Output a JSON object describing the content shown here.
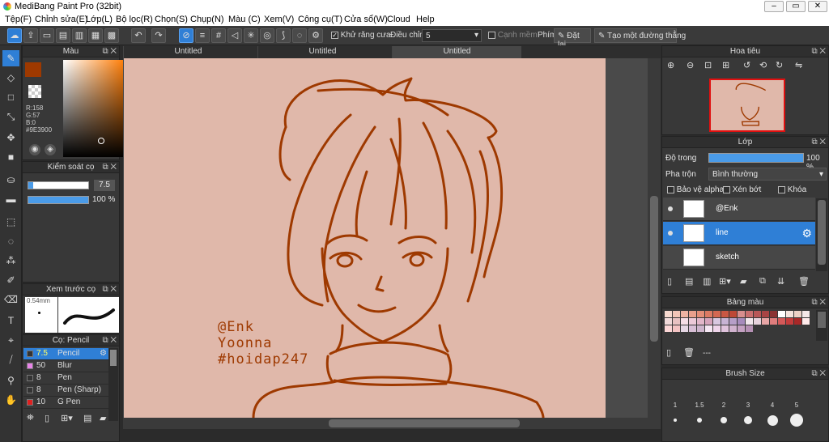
{
  "app": {
    "title": "MediBang Paint Pro (32bit)"
  },
  "menu": [
    "Tệp(F)",
    "Chỉnh sửa(E)",
    "Lớp(L)",
    "Bộ lọc(R)",
    "Chọn(S)",
    "Chụp(N)",
    "Màu (C)",
    "Xem(V)",
    "Công cụ(T)",
    "Cửa sổ(W)",
    "Cloud",
    "Help"
  ],
  "toolbar": {
    "antialias_label": "Khử răng cưa",
    "adjust_label": "Điều chỉnh",
    "adjust_value": "5",
    "margin_label": "Cạnh mềm",
    "key_label": "Phím",
    "reset_label": "Đặt lại",
    "straight_line_label": "Tạo một đường thẳng"
  },
  "color_panel": {
    "title": "Màu",
    "rgb": {
      "r": "R:158",
      "g": "G:57",
      "b": "B:0"
    },
    "hex": "#9E3900",
    "primary": "#9e3900",
    "secondary": "#ffffff"
  },
  "brush_control": {
    "title": "Kiểm soát cọ",
    "size": "7.5",
    "opacity": "100 %",
    "size_fraction": 0.08,
    "opacity_fraction": 1.0
  },
  "brush_preview": {
    "title": "Xem trước cọ",
    "size_label": "0.54mm"
  },
  "brush_list": {
    "title": "Cọ: Pencil",
    "items": [
      {
        "size": "7.5",
        "name": "Pencil",
        "color": "#333333",
        "selected": true
      },
      {
        "size": "50",
        "name": "Blur",
        "color": "#e884e8",
        "selected": false
      },
      {
        "size": "8",
        "name": "Pen",
        "color": "#333333",
        "selected": false
      },
      {
        "size": "8",
        "name": "Pen (Sharp)",
        "color": "#333333",
        "selected": false
      },
      {
        "size": "10",
        "name": "G Pen",
        "color": "#e02020",
        "selected": false
      }
    ]
  },
  "tabs": [
    {
      "label": "Untitled",
      "active": false
    },
    {
      "label": "Untitled",
      "active": false
    },
    {
      "label": "Untitled",
      "active": true
    }
  ],
  "canvas": {
    "background": "#e0b8aa",
    "line_color": "#9e3900",
    "signature": [
      "@Enk",
      "Yoonna",
      "#hoidap247"
    ]
  },
  "navigator": {
    "title": "Hoa tiêu"
  },
  "layers": {
    "title": "Lớp",
    "opacity_label": "Độ trong",
    "opacity_value": "100 %",
    "blend_label": "Pha trộn",
    "blend_value": "Bình thường",
    "protect_alpha": "Bảo vệ alpha",
    "clipping": "Xén bớt",
    "lock": "Khóa",
    "items": [
      {
        "name": "@Enk",
        "selected": false
      },
      {
        "name": "line",
        "selected": true
      },
      {
        "name": "sketch",
        "selected": false
      }
    ]
  },
  "palette": {
    "title": "Bảng màu",
    "dash": "---",
    "colors": [
      "#f7d9cf",
      "#f3c6b8",
      "#efb4a3",
      "#e9a08c",
      "#e38d77",
      "#dc7a63",
      "#d36852",
      "#c95743",
      "#bd4837",
      "#d88e8e",
      "#c96f6f",
      "#b85757",
      "#a84444",
      "#8c3333",
      "#ffffff",
      "#f4e3dd",
      "#ecd1c6",
      "#f5e8e8",
      "#f0d9d9",
      "#e8c2c2",
      "#f5dde5",
      "#eccad8",
      "#e2b6c9",
      "#d6a3bb",
      "#d8c8e0",
      "#c7b3d4",
      "#b69fc8",
      "#a68bbc",
      "#f1e7ec",
      "#e6d2dc",
      "#e8a6a6",
      "#e07d7d",
      "#d45959",
      "#c43c3c",
      "#a82828",
      "#ffeaea",
      "#fbd6d6",
      "#f4c3c3",
      "#e5d6e3",
      "#d8bfd6",
      "#cdb4cc",
      "#f6e7f3",
      "#efd5ea",
      "#e0c3dd",
      "#d1b3cf",
      "#c4a1c2",
      "#b590b4"
    ]
  },
  "brush_size": {
    "title": "Brush Size",
    "sizes": [
      "1",
      "1.5",
      "2",
      "3",
      "4",
      "5"
    ]
  }
}
